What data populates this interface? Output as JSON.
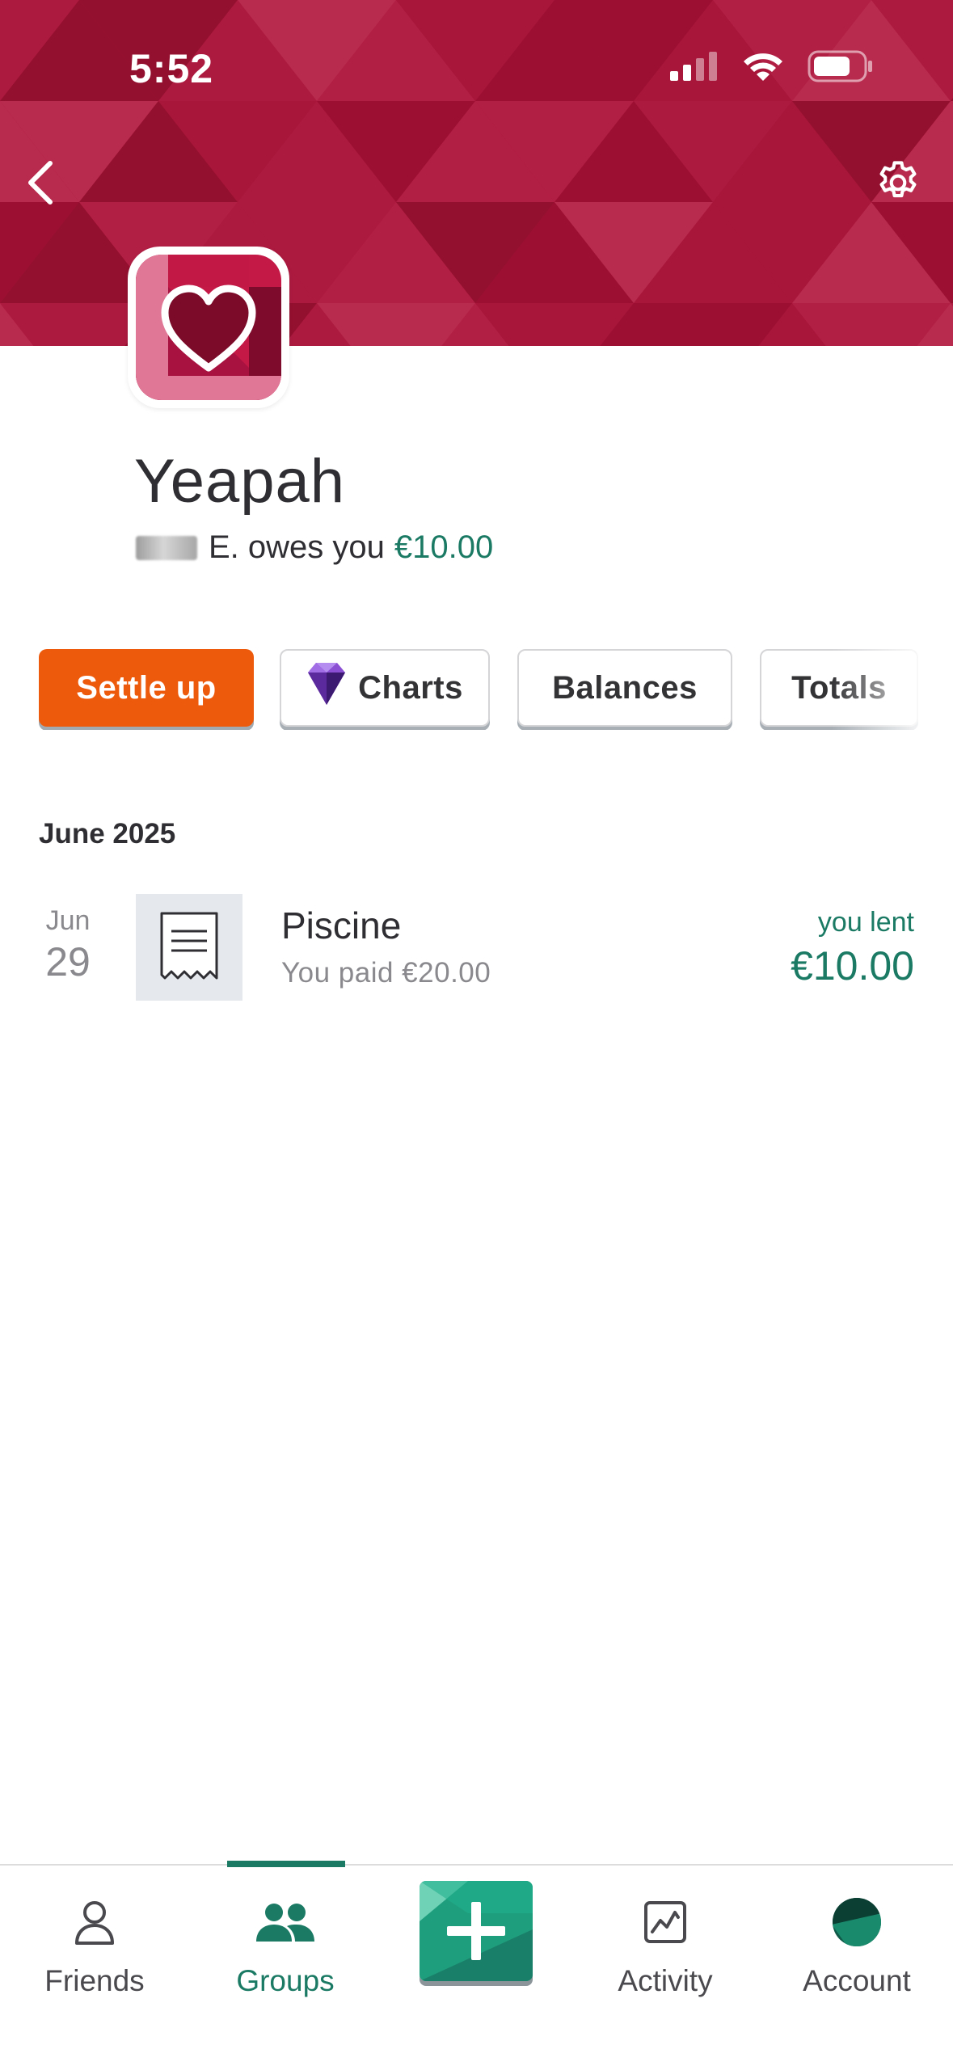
{
  "status_bar": {
    "time": "5:52"
  },
  "header": {
    "back_icon": "chevron-left-icon",
    "settings_icon": "gear-icon",
    "banner_color": "#a8163a"
  },
  "group": {
    "name": "Yeapah",
    "avatar_icon": "heart-icon",
    "balance_text": "E. owes you",
    "balance_amount": "€10.00"
  },
  "actions": {
    "settle_up": "Settle up",
    "charts": "Charts",
    "balances": "Balances",
    "totals": "Totals"
  },
  "expenses": {
    "section": "June 2025",
    "items": [
      {
        "month": "Jun",
        "day": "29",
        "title": "Piscine",
        "subtitle": "You paid €20.00",
        "lent_label": "you lent",
        "lent_amount": "€10.00"
      }
    ]
  },
  "tabbar": {
    "friends": "Friends",
    "groups": "Groups",
    "activity": "Activity",
    "account": "Account",
    "active": "Groups"
  },
  "colors": {
    "accent_green": "#1b7a64",
    "settle_orange": "#ee5a0c",
    "banner_red": "#a8163a"
  }
}
